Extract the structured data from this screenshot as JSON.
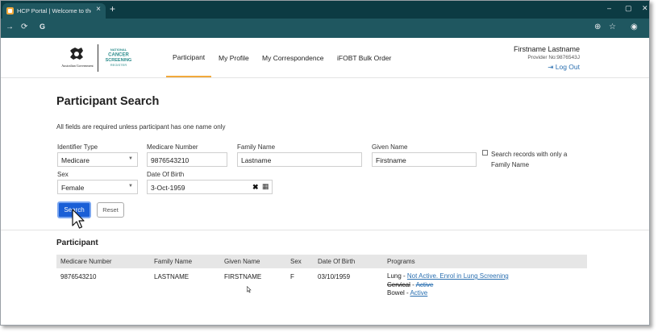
{
  "browser": {
    "tab_title": "HCP Portal | Welcome to the D",
    "close_glyph": "×",
    "newtab_glyph": "+",
    "minimize_glyph": "–",
    "maximize_glyph": "▢",
    "close_window_glyph": "✕",
    "forward_glyph": "→",
    "reload_glyph": "⟳",
    "google_glyph": "G",
    "zoom_glyph": "⊕",
    "star_glyph": "☆",
    "profile_glyph": "◉"
  },
  "header": {
    "nav": [
      "Participant",
      "My Profile",
      "My Correspondence",
      "iFOBT Bulk Order"
    ],
    "user_name": "Firstname Lastname",
    "provider": "Provider No:9876543J",
    "logout_icon": "⇥",
    "logout": "Log Out",
    "gov_text": "Australian Government",
    "ncsr_lines": [
      "NATIONAL",
      "CANCER",
      "SCREENING",
      "REGISTER"
    ]
  },
  "form": {
    "title": "Participant Search",
    "intro": "All fields are required unless participant has one name only",
    "identifier_type_label": "Identifier Type",
    "identifier_type_value": "Medicare",
    "medicare_label": "Medicare Number",
    "medicare_value": "9876543210",
    "family_label": "Family Name",
    "family_value": "Lastname",
    "given_label": "Given Name",
    "given_value": "Firstname",
    "family_only_label": "Search records with only a Family Name",
    "sex_label": "Sex",
    "sex_value": "Female",
    "dob_label": "Date Of Birth",
    "dob_value": "3-Oct-1959",
    "clear_glyph": "✖",
    "calendar_glyph": "▦",
    "caret_glyph": "▼",
    "search_btn": "Search",
    "reset_btn": "Reset"
  },
  "results": {
    "title": "Participant",
    "headers": [
      "Medicare Number",
      "Family Name",
      "Given Name",
      "Sex",
      "Date Of Birth",
      "Programs"
    ],
    "row": {
      "medicare": "9876543210",
      "family": "LASTNAME",
      "given": "FIRSTNAME",
      "sex": "F",
      "dob": "03/10/1959",
      "lung_label": "Lung - ",
      "lung_status": "Not Active. Enrol in Lung Screening",
      "cervical_label": "Cervical",
      "cervical_sep": " - ",
      "cervical_status": "Active",
      "bowel_label": "Bowel - ",
      "bowel_status": "Active"
    }
  },
  "colors": {
    "chrome_dark": "#0c3b43",
    "chrome_bar": "#1f5760",
    "accent": "#f2a93b",
    "primary": "#1a5fd6",
    "link": "#2a6fb0"
  }
}
